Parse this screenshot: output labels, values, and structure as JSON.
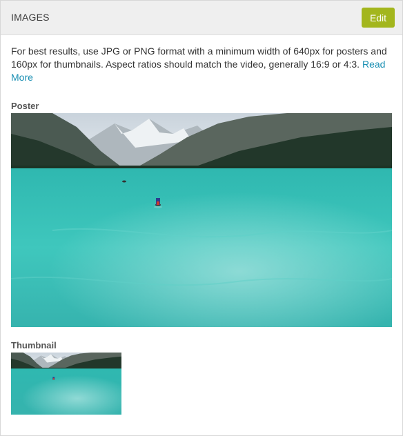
{
  "panel": {
    "title": "IMAGES",
    "edit_label": "Edit"
  },
  "help": {
    "text": "For best results, use JPG or PNG format with a minimum width of 640px for posters and 160px for thumbnails. Aspect ratios should match the video, generally 16:9 or 4:3.",
    "read_more": "Read More"
  },
  "poster": {
    "label": "Poster"
  },
  "thumbnail": {
    "label": "Thumbnail"
  },
  "colors": {
    "accent": "#a3b61d",
    "link": "#1a8fb3",
    "header_bg": "#efefef"
  }
}
